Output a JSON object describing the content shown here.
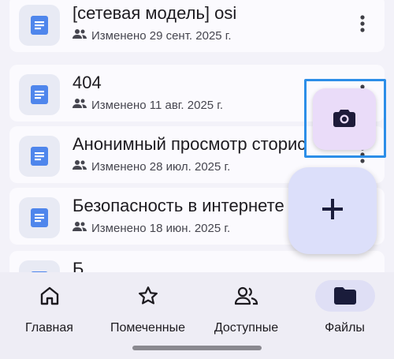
{
  "files": [
    {
      "title": "[сетевая модель] osi",
      "modified": "Изменено 29 сент. 2025 г."
    },
    {
      "title": "404",
      "modified": "Изменено 11 авг. 2025 г."
    },
    {
      "title": "Анонимный просмотр сторис",
      "modified": "Изменено 28 июл. 2025 г."
    },
    {
      "title": "Безопасность в интернете",
      "modified": "Изменено 18 июн. 2025 г."
    },
    {
      "title": "Б",
      "modified": ""
    }
  ],
  "icons": {
    "doc": "doc-icon",
    "shared": "people-icon",
    "more": "more-vert-icon",
    "camera": "camera-icon",
    "add": "plus-icon"
  },
  "colors": {
    "doc_blue": "#4f86ec",
    "highlight": "#2c8ee8",
    "camera_fab": "#eadcf9",
    "add_fab": "#dcdffa"
  },
  "nav": {
    "home": "Главная",
    "starred": "Помеченные",
    "shared": "Доступные",
    "files": "Файлы",
    "active": "files"
  }
}
